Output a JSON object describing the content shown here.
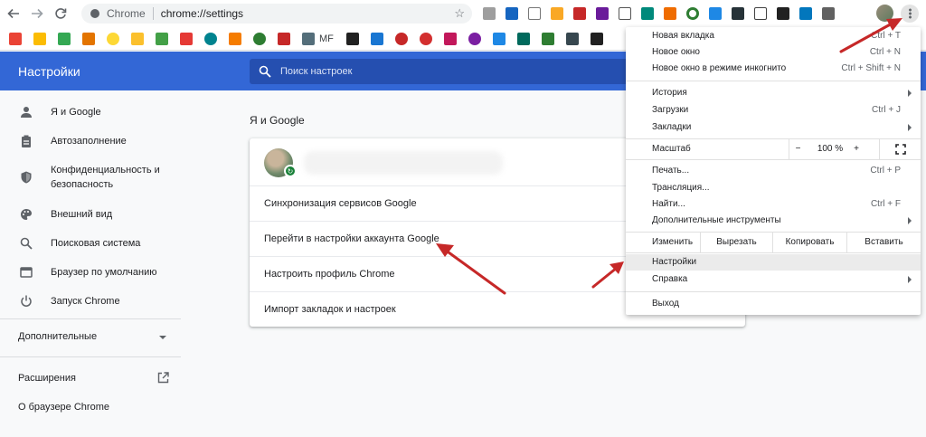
{
  "browser": {
    "site_chip": "Chrome",
    "url": "chrome://settings",
    "bookmark_text": "MF"
  },
  "header": {
    "title": "Настройки",
    "search_placeholder": "Поиск настроек"
  },
  "sidebar": {
    "items": [
      {
        "label": "Я и Google",
        "icon": "person-icon"
      },
      {
        "label": "Автозаполнение",
        "icon": "clipboard-icon"
      },
      {
        "label": "Конфиденциальность и безопасность",
        "icon": "shield-icon"
      },
      {
        "label": "Внешний вид",
        "icon": "palette-icon"
      },
      {
        "label": "Поисковая система",
        "icon": "search-icon"
      },
      {
        "label": "Браузер по умолчанию",
        "icon": "browser-icon"
      },
      {
        "label": "Запуск Chrome",
        "icon": "power-icon"
      }
    ],
    "advanced": "Дополнительные",
    "extensions": "Расширения",
    "about": "О браузере Chrome"
  },
  "main": {
    "section_title": "Я и Google",
    "rows": [
      "Синхронизация сервисов Google",
      "Перейти в настройки аккаунта Google",
      "Настроить профиль Chrome",
      "Импорт закладок и настроек"
    ]
  },
  "menu": {
    "group1": [
      {
        "label": "Новая вкладка",
        "shortcut": "Ctrl + T"
      },
      {
        "label": "Новое окно",
        "shortcut": "Ctrl + N"
      },
      {
        "label": "Новое окно в режиме инкогнито",
        "shortcut": "Ctrl + Shift + N"
      }
    ],
    "group2": [
      {
        "label": "История",
        "shortcut": ""
      },
      {
        "label": "Загрузки",
        "shortcut": "Ctrl + J"
      },
      {
        "label": "Закладки",
        "shortcut": ""
      }
    ],
    "zoom": {
      "label": "Масштаб",
      "minus": "−",
      "value": "100 %",
      "plus": "+"
    },
    "group3": [
      {
        "label": "Печать...",
        "shortcut": "Ctrl + P"
      },
      {
        "label": "Трансляция...",
        "shortcut": ""
      },
      {
        "label": "Найти...",
        "shortcut": "Ctrl + F"
      },
      {
        "label": "Дополнительные инструменты",
        "shortcut": ""
      }
    ],
    "edit": {
      "label": "Изменить",
      "cut": "Вырезать",
      "copy": "Копировать",
      "paste": "Вставить"
    },
    "settings": "Настройки",
    "help": "Справка",
    "exit": "Выход"
  },
  "colors": {
    "header": "#3367d6",
    "annotation_arrow": "#c62828"
  }
}
